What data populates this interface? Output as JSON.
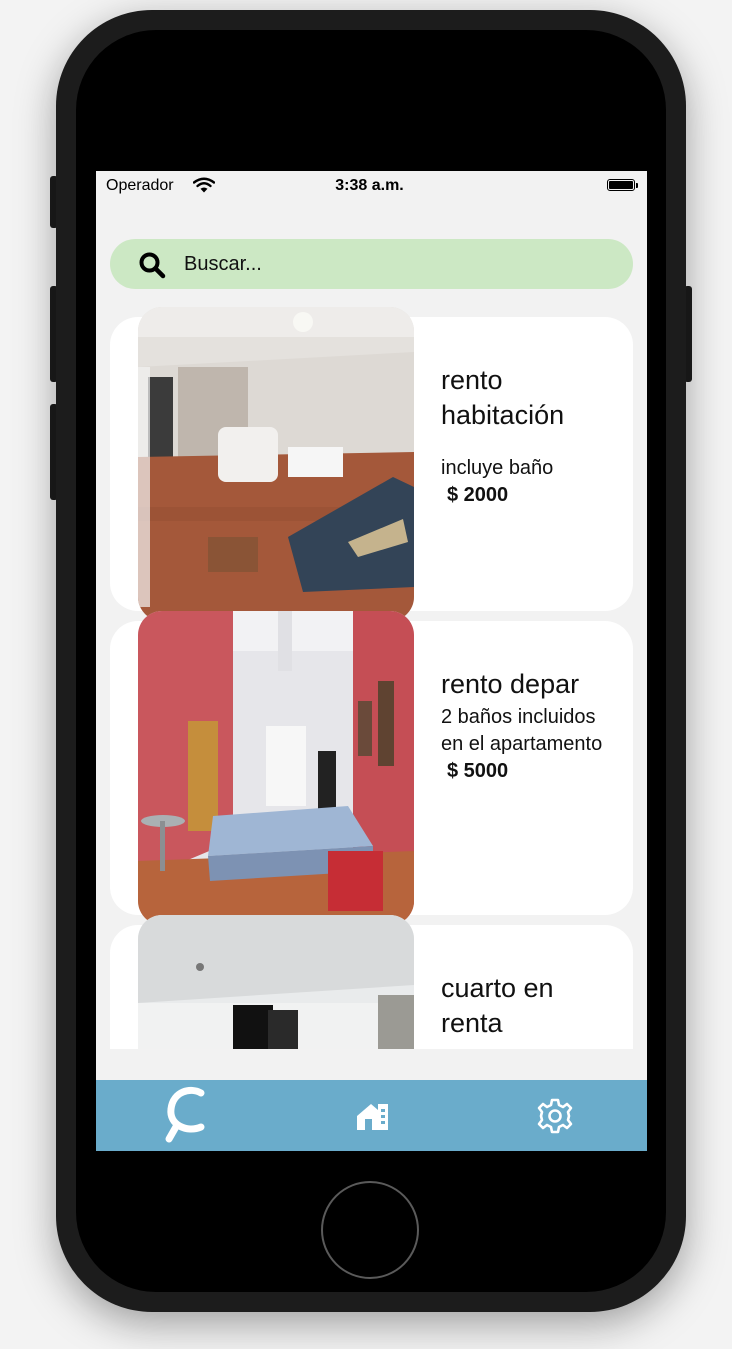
{
  "status_bar": {
    "carrier": "Operador",
    "time": "3:38 a.m."
  },
  "search": {
    "placeholder": "Buscar..."
  },
  "listings": [
    {
      "title": "rento habitación",
      "description": "incluye baño",
      "price": "$ 2000"
    },
    {
      "title": "rento depar",
      "description": "2 baños incluidos en el apartamento",
      "price": "$ 5000"
    },
    {
      "title": "cuarto en renta",
      "description": "",
      "price": ""
    }
  ],
  "tabbar": {
    "items": [
      "search-tab",
      "properties-tab",
      "settings-tab"
    ]
  },
  "colors": {
    "search_bg": "#cce8c4",
    "tabbar_bg": "#6aaccb",
    "card_bg": "#ffffff",
    "screen_bg": "#f2f2f2"
  }
}
